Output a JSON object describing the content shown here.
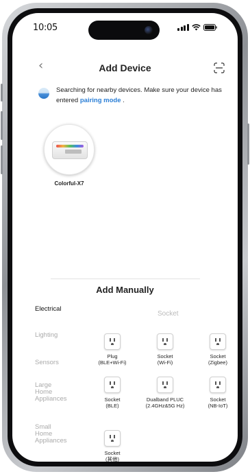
{
  "status_bar": {
    "time": "10:05",
    "icons": [
      "signal-icon",
      "wifi-icon",
      "battery-icon"
    ]
  },
  "header": {
    "title": "Add Device",
    "back_icon": "chevron-left-icon",
    "scan_icon": "scan-icon"
  },
  "notice": {
    "text_before": "Searching for nearby devices. Make sure your device has entered ",
    "link": "pairing mode",
    "text_after": " ."
  },
  "found_devices": [
    {
      "name": "Colorful-X7"
    }
  ],
  "manual": {
    "title": "Add Manually",
    "categories": [
      {
        "label": "Electrical",
        "active": true
      },
      {
        "label": "Lighting",
        "active": false
      },
      {
        "label": "Sensors",
        "active": false
      },
      {
        "label": "Large Home Appliances",
        "active": false
      },
      {
        "label": "Small Home Appliances",
        "active": false
      }
    ],
    "section_title": "Socket",
    "items": [
      {
        "line1": "Plug",
        "line2": "(BLE+Wi-Fi)"
      },
      {
        "line1": "Socket",
        "line2": "(Wi-Fi)"
      },
      {
        "line1": "Socket",
        "line2": "(Zigbee)"
      },
      {
        "line1": "Socket",
        "line2": "(BLE)"
      },
      {
        "line1": "Dualband PLUC",
        "line2": "(2.4GHz&5G Hz)"
      },
      {
        "line1": "Socket",
        "line2": "(NB-IoT)"
      },
      {
        "line1": "Socket",
        "line2": "(其他)"
      }
    ]
  },
  "colors": {
    "link": "#2b7fd6",
    "active_category": "#111111",
    "inactive_category": "#aaaaaa"
  }
}
